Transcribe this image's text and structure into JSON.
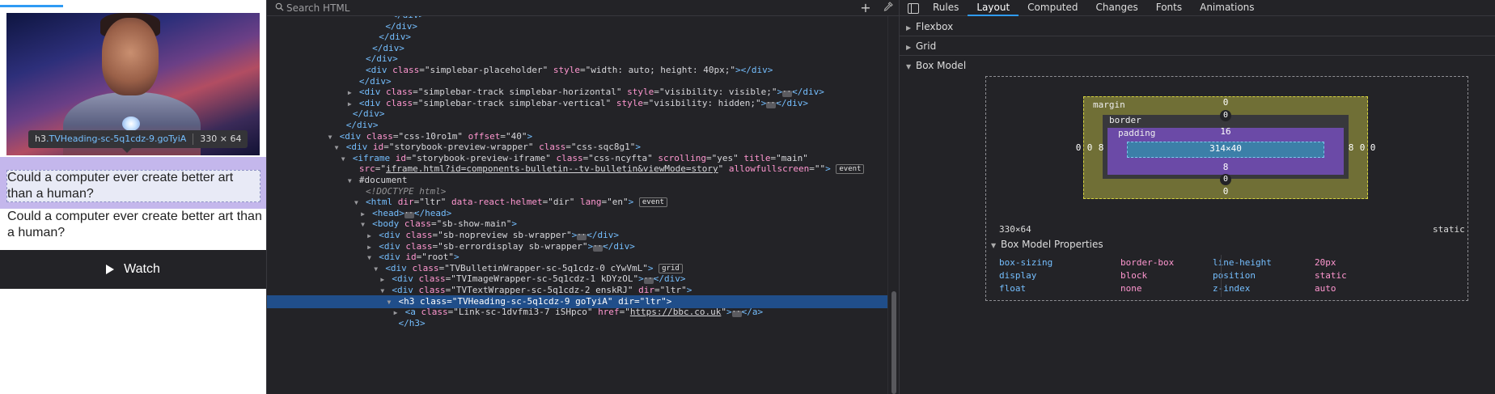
{
  "preview": {
    "tooltip": {
      "tag": "h3",
      "cls": ".TVHeading-sc-5q1cdz-9.goTyiA",
      "dims": "330 × 64"
    },
    "heading": "Could a computer ever create better art than a human?",
    "paragraph": "Could a computer ever create better art than a human?",
    "watch_label": "Watch"
  },
  "inspector": {
    "search_placeholder": "Search HTML",
    "rows": [
      {
        "indent": 18,
        "tw": "",
        "html": "<span class=\"t\">&lt;/div&gt;</span>"
      },
      {
        "indent": 17,
        "tw": "",
        "html": "<span class=\"t\">&lt;/div&gt;</span>"
      },
      {
        "indent": 16,
        "tw": "",
        "html": "<span class=\"t\">&lt;/div&gt;</span>"
      },
      {
        "indent": 15,
        "tw": "",
        "html": "<span class=\"t\">&lt;/div&gt;</span>"
      },
      {
        "indent": 14,
        "tw": "",
        "html": "<span class=\"t\">&lt;/div&gt;</span>"
      },
      {
        "indent": 14,
        "tw": "",
        "html": "<span class=\"t\">&lt;div</span> <span class=\"an\">class</span>=<span class=\"av\">\"simplebar-placeholder\"</span> <span class=\"an\">style</span>=<span class=\"av\">\"width: auto; height: 40px;\"</span><span class=\"t\">&gt;&lt;/div&gt;</span>"
      },
      {
        "indent": 13,
        "tw": "",
        "html": "<span class=\"t\">&lt;/div&gt;</span>"
      },
      {
        "indent": 13,
        "tw": "▶",
        "html": "<span class=\"t\">&lt;div</span> <span class=\"an\">class</span>=<span class=\"av\">\"simplebar-track simplebar-horizontal\"</span> <span class=\"an\">style</span>=<span class=\"av\">\"visibility: visible;\"</span><span class=\"t\">&gt;</span><span class=\"dots\">···</span><span class=\"t\">&lt;/div&gt;</span>"
      },
      {
        "indent": 13,
        "tw": "▶",
        "html": "<span class=\"t\">&lt;div</span> <span class=\"an\">class</span>=<span class=\"av\">\"simplebar-track simplebar-vertical\"</span> <span class=\"an\">style</span>=<span class=\"av\">\"visibility: hidden;\"</span><span class=\"t\">&gt;</span><span class=\"dots\">···</span><span class=\"t\">&lt;/div&gt;</span>"
      },
      {
        "indent": 12,
        "tw": "",
        "html": "<span class=\"t\">&lt;/div&gt;</span>"
      },
      {
        "indent": 11,
        "tw": "",
        "html": "<span class=\"t\">&lt;/div&gt;</span>"
      },
      {
        "indent": 10,
        "tw": "▼",
        "html": "<span class=\"t\">&lt;div</span> <span class=\"an\">class</span>=<span class=\"av\">\"css-10ro1m\"</span> <span class=\"an\">offset</span>=<span class=\"av\">\"40\"</span><span class=\"t\">&gt;</span>"
      },
      {
        "indent": 11,
        "tw": "▼",
        "html": "<span class=\"t\">&lt;div</span> <span class=\"an\">id</span>=<span class=\"av\">\"storybook-preview-wrapper\"</span> <span class=\"an\">class</span>=<span class=\"av\">\"css-sqc8g1\"</span><span class=\"t\">&gt;</span>"
      },
      {
        "indent": 12,
        "tw": "▼",
        "html": "<span class=\"t\">&lt;iframe</span> <span class=\"an\">id</span>=<span class=\"av\">\"storybook-preview-iframe\"</span> <span class=\"an\">class</span>=<span class=\"av\">\"css-ncyfta\"</span> <span class=\"an\">scrolling</span>=<span class=\"av\">\"yes\"</span> <span class=\"an\">title</span>=<span class=\"av\">\"main\"</span>"
      },
      {
        "indent": 13,
        "tw": "",
        "html": "<span class=\"an\">src</span>=<span class=\"av\">\"<span class=\"link\">iframe.html?id=components-bulletin--tv-bulletin&amp;viewMode=story</span>\"</span> <span class=\"an\">allowfullscreen</span>=<span class=\"av\">\"\"</span><span class=\"t\">&gt;</span> <span class=\"badge\">event</span>"
      },
      {
        "indent": 13,
        "tw": "▼",
        "html": "<span class=\"av\">#document</span>"
      },
      {
        "indent": 14,
        "tw": "",
        "html": "<span class=\"cm\">&lt;!DOCTYPE html&gt;</span>"
      },
      {
        "indent": 14,
        "tw": "▼",
        "html": "<span class=\"t\">&lt;html</span> <span class=\"an\">dir</span>=<span class=\"av\">\"ltr\"</span> <span class=\"an\">data-react-helmet</span>=<span class=\"av\">\"dir\"</span> <span class=\"an\">lang</span>=<span class=\"av\">\"en\"</span><span class=\"t\">&gt;</span> <span class=\"badge\">event</span>"
      },
      {
        "indent": 15,
        "tw": "▶",
        "html": "<span class=\"t\">&lt;head&gt;</span><span class=\"dots\">···</span><span class=\"t\">&lt;/head&gt;</span>"
      },
      {
        "indent": 15,
        "tw": "▼",
        "html": "<span class=\"t\">&lt;body</span> <span class=\"an\">class</span>=<span class=\"av\">\"sb-show-main\"</span><span class=\"t\">&gt;</span>"
      },
      {
        "indent": 16,
        "tw": "▶",
        "html": "<span class=\"t\">&lt;div</span> <span class=\"an\">class</span>=<span class=\"av\">\"sb-nopreview sb-wrapper\"</span><span class=\"t\">&gt;</span><span class=\"dots\">···</span><span class=\"t\">&lt;/div&gt;</span>"
      },
      {
        "indent": 16,
        "tw": "▶",
        "html": "<span class=\"t\">&lt;div</span> <span class=\"an\">class</span>=<span class=\"av\">\"sb-errordisplay sb-wrapper\"</span><span class=\"t\">&gt;</span><span class=\"dots\">···</span><span class=\"t\">&lt;/div&gt;</span>"
      },
      {
        "indent": 16,
        "tw": "▼",
        "html": "<span class=\"t\">&lt;div</span> <span class=\"an\">id</span>=<span class=\"av\">\"root\"</span><span class=\"t\">&gt;</span>"
      },
      {
        "indent": 17,
        "tw": "▼",
        "html": "<span class=\"t\">&lt;div</span> <span class=\"an\">class</span>=<span class=\"av\">\"TVBulletinWrapper-sc-5q1cdz-0 cYwVmL\"</span><span class=\"t\">&gt;</span> <span class=\"badge\">grid</span>"
      },
      {
        "indent": 18,
        "tw": "▶",
        "html": "<span class=\"t\">&lt;div</span> <span class=\"an\">class</span>=<span class=\"av\">\"TVImageWrapper-sc-5q1cdz-1 kDYzOL\"</span><span class=\"t\">&gt;</span><span class=\"dots\">···</span><span class=\"t\">&lt;/div&gt;</span>"
      },
      {
        "indent": 18,
        "tw": "▼",
        "html": "<span class=\"t\">&lt;div</span> <span class=\"an\">class</span>=<span class=\"av\">\"TVTextWrapper-sc-5q1cdz-2 enskRJ\"</span> <span class=\"an\">dir</span>=<span class=\"av\">\"ltr\"</span><span class=\"t\">&gt;</span>"
      },
      {
        "indent": 19,
        "tw": "▼",
        "html": "<span class=\"t\">&lt;h3</span> <span class=\"an\">class</span>=<span class=\"av\">\"TVHeading-sc-5q1cdz-9 goTyiA\"</span> <span class=\"an\">dir</span>=<span class=\"av\">\"ltr\"</span><span class=\"t\">&gt;</span>",
        "selected": true
      },
      {
        "indent": 20,
        "tw": "▶",
        "html": "<span class=\"t\">&lt;a</span> <span class=\"an\">class</span>=<span class=\"av\">\"Link-sc-1dvfmi3-7 iSHpco\"</span> <span class=\"an\">href</span>=<span class=\"av\">\"<span class=\"link\">https://bbc.co.uk</span>\"</span><span class=\"t\">&gt;</span><span class=\"dots\">···</span><span class=\"t\">&lt;/a&gt;</span>"
      },
      {
        "indent": 19,
        "tw": "",
        "html": "<span class=\"t\">&lt;/h3&gt;</span>"
      }
    ]
  },
  "layout": {
    "tabs": [
      {
        "label": "Rules",
        "active": false
      },
      {
        "label": "Layout",
        "active": true
      },
      {
        "label": "Computed",
        "active": false
      },
      {
        "label": "Changes",
        "active": false
      },
      {
        "label": "Fonts",
        "active": false
      },
      {
        "label": "Animations",
        "active": false
      }
    ],
    "sections": {
      "flexbox": "Flexbox",
      "grid": "Grid",
      "box_model": "Box Model"
    },
    "box_model": {
      "margin_label": "margin",
      "border_label": "border",
      "padding_label": "padding",
      "margin": {
        "top": "0",
        "right": "0",
        "bottom": "0",
        "left": "0"
      },
      "border": {
        "top": "0",
        "right": "0",
        "bottom": "0",
        "left": "0"
      },
      "padding": {
        "top": "16",
        "right": "8",
        "bottom": "8",
        "left": "8"
      },
      "content": "314×40",
      "dims": "330×64",
      "position": "static"
    },
    "props_title": "Box Model Properties",
    "props": [
      {
        "name": "box-sizing",
        "value": "border-box"
      },
      {
        "name": "display",
        "value": "block"
      },
      {
        "name": "float",
        "value": "none"
      },
      {
        "name": "line-height",
        "value": "20px"
      },
      {
        "name": "position",
        "value": "static"
      },
      {
        "name": "z-index",
        "value": "auto"
      }
    ]
  }
}
